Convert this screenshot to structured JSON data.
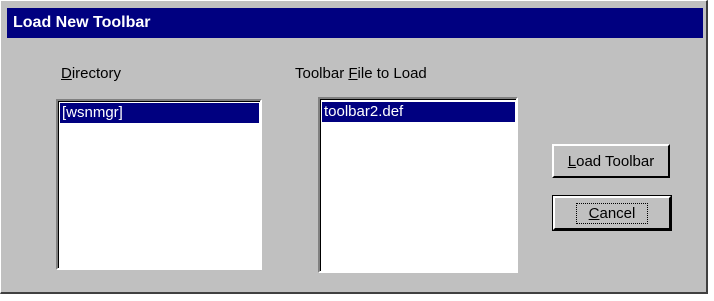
{
  "window": {
    "title": "Load New Toolbar"
  },
  "directory": {
    "label_prefix": "",
    "label_accel": "D",
    "label_rest": "irectory",
    "items": [
      "[wsnmgr]"
    ]
  },
  "toolbar_file": {
    "label_prefix": "Toolbar ",
    "label_accel": "F",
    "label_rest": "ile to Load",
    "items": [
      "toolbar2.def"
    ]
  },
  "buttons": {
    "load": {
      "accel": "L",
      "rest": "oad Toolbar"
    },
    "cancel": {
      "accel": "C",
      "rest": "ancel"
    }
  }
}
